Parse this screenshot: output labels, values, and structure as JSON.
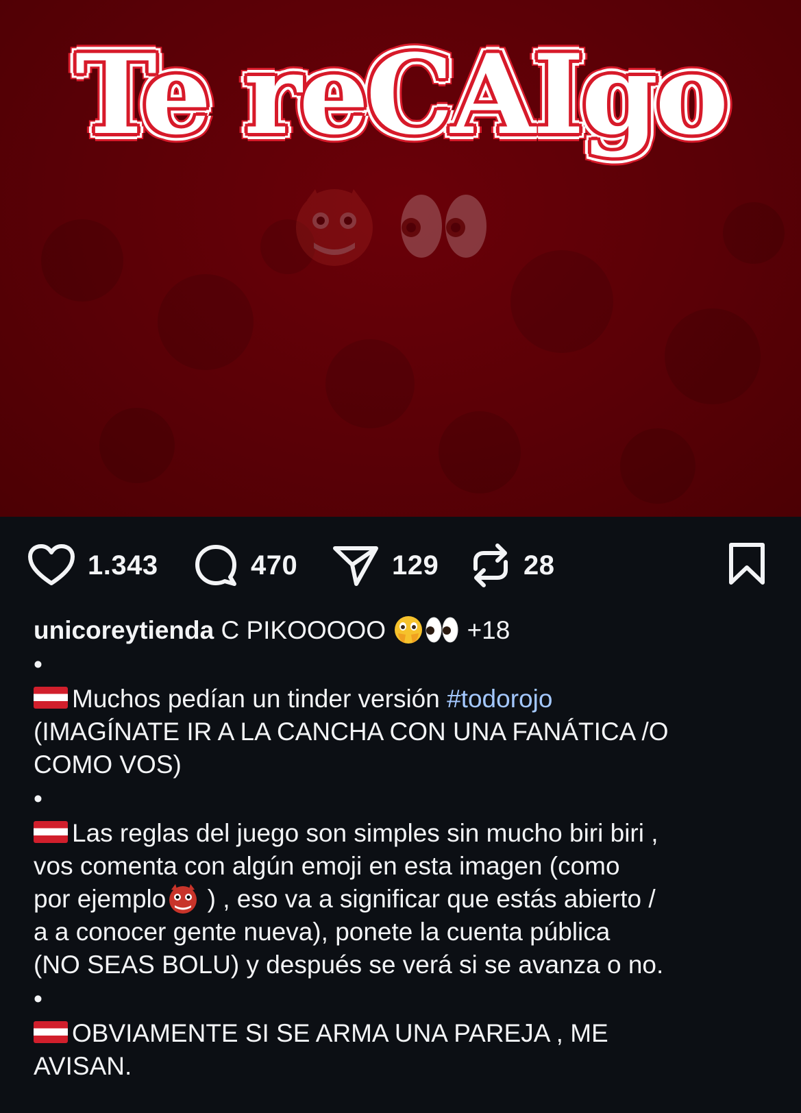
{
  "post": {
    "headline": "Te reCAIgo",
    "bg_color": "#5a0006",
    "accent_red": "#d71a2a",
    "image_emojis": [
      "ogre-icon",
      "eyes-icon"
    ]
  },
  "actions": {
    "likes": "1.343",
    "comments": "470",
    "shares": "129",
    "reposts": "28"
  },
  "caption": {
    "username": "unicoreytienda",
    "title_text": "C PIKOOOOO",
    "title_suffix": "+18",
    "bullet": "•",
    "p1_text": "Muchos pedían un tinder versión ",
    "p1_hashtag": "#todorojo",
    "p1_line2": "(IMAGÍNATE IR A LA CANCHA CON UNA FANÁTICA /O",
    "p1_line3": "COMO VOS)",
    "p2_line1": "Las reglas del juego son simples sin mucho biri biri ,",
    "p2_line2": "vos comenta con algún emoji en esta imagen (como",
    "p2_line3a": "por ejemplo",
    "p2_line3b": " ) , eso va a significar que estás abierto /",
    "p2_line4": "a a conocer gente nueva), ponete la cuenta pública",
    "p2_line5": "(NO SEAS BOLU) y después se verá si se avanza o no.",
    "p3_line1": "OBVIAMENTE SI SE ARMA UNA PAREJA , ME",
    "p3_line2": "AVISAN."
  }
}
